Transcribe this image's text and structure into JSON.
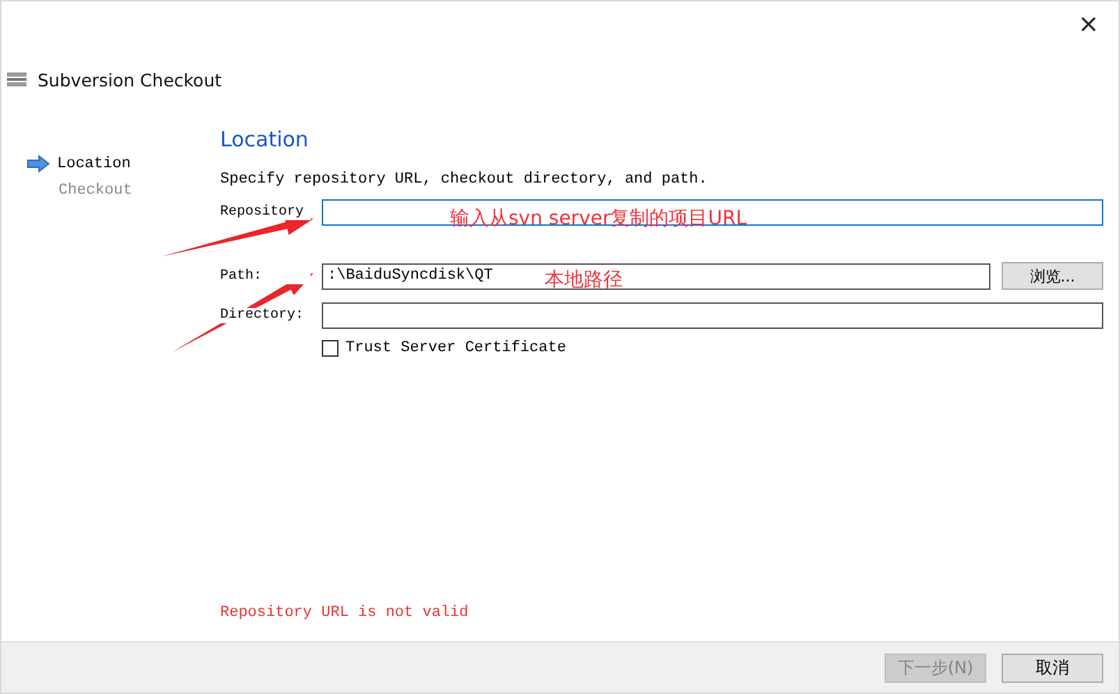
{
  "window": {
    "title": "Subversion Checkout",
    "close": "×"
  },
  "steps": [
    {
      "label": "Location",
      "selected": true
    },
    {
      "label": "Checkout",
      "selected": false
    }
  ],
  "page": {
    "heading": "Location",
    "description": "Specify repository URL, checkout directory, and path.",
    "fields": [
      {
        "label": "Repository",
        "focused": true
      },
      {
        "label": "Path:",
        "value": ":\\BaiduSyncdisk\\QT",
        "focused": false,
        "button": "浏览..."
      },
      {
        "label": "Directory:",
        "focused": false
      }
    ],
    "trust_certificate": {
      "label": "Trust Server Certificate",
      "checked": false
    },
    "error": "Repository URL is not valid"
  },
  "annotations": [
    {
      "text": "输入从svn server复制的项目URL"
    },
    {
      "text": "本地路径"
    }
  ],
  "buttons": [
    {
      "label": "下一步(N)",
      "disabled": true
    },
    {
      "label": "取消",
      "disabled": false
    }
  ]
}
